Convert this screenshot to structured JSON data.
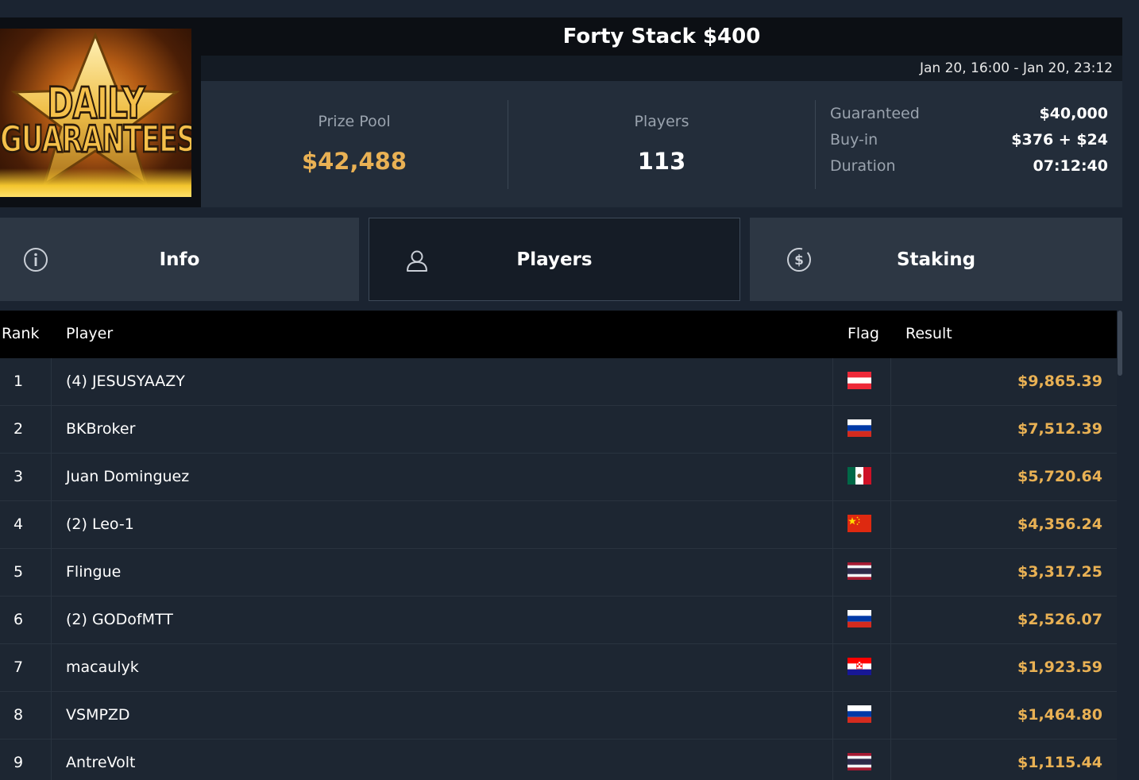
{
  "logo": {
    "line1": "DAILY",
    "line2": "GUARANTEES"
  },
  "tournament": {
    "title": "Forty Stack $400",
    "dates": "Jan 20, 16:00 - Jan 20, 23:12"
  },
  "stats": {
    "prize_pool_label": "Prize Pool",
    "prize_pool_value": "$42,488",
    "players_label": "Players",
    "players_value": "113",
    "details": [
      {
        "key": "Guaranteed",
        "value": "$40,000"
      },
      {
        "key": "Buy-in",
        "value": "$376 + $24"
      },
      {
        "key": "Duration",
        "value": "07:12:40"
      }
    ]
  },
  "tabs": [
    {
      "label": "Info",
      "icon": "info-icon",
      "active": false
    },
    {
      "label": "Players",
      "icon": "user-icon",
      "active": true
    },
    {
      "label": "Staking",
      "icon": "dollar-coin-icon",
      "active": false
    }
  ],
  "table": {
    "headers": {
      "rank": "Rank",
      "player": "Player",
      "flag": "Flag",
      "result": "Result"
    },
    "rows": [
      {
        "rank": "1",
        "player": "(4) JESUSYAAZY",
        "flag": "austria",
        "result": "$9,865.39"
      },
      {
        "rank": "2",
        "player": "BKBroker",
        "flag": "russia",
        "result": "$7,512.39"
      },
      {
        "rank": "3",
        "player": "Juan Dominguez",
        "flag": "mexico",
        "result": "$5,720.64"
      },
      {
        "rank": "4",
        "player": "(2) Leo-1",
        "flag": "china",
        "result": "$4,356.24"
      },
      {
        "rank": "5",
        "player": "Flingue",
        "flag": "thailand",
        "result": "$3,317.25"
      },
      {
        "rank": "6",
        "player": "(2) GODofMTT",
        "flag": "russia",
        "result": "$2,526.07"
      },
      {
        "rank": "7",
        "player": "macaulyk",
        "flag": "croatia",
        "result": "$1,923.59"
      },
      {
        "rank": "8",
        "player": "VSMPZD",
        "flag": "russia",
        "result": "$1,464.80"
      },
      {
        "rank": "9",
        "player": "AntreVolt",
        "flag": "thailand",
        "result": "$1,115.44"
      }
    ]
  },
  "colors": {
    "accent_gold": "#e9b154",
    "background": "#1b2431",
    "active_tab": "#151c26"
  }
}
